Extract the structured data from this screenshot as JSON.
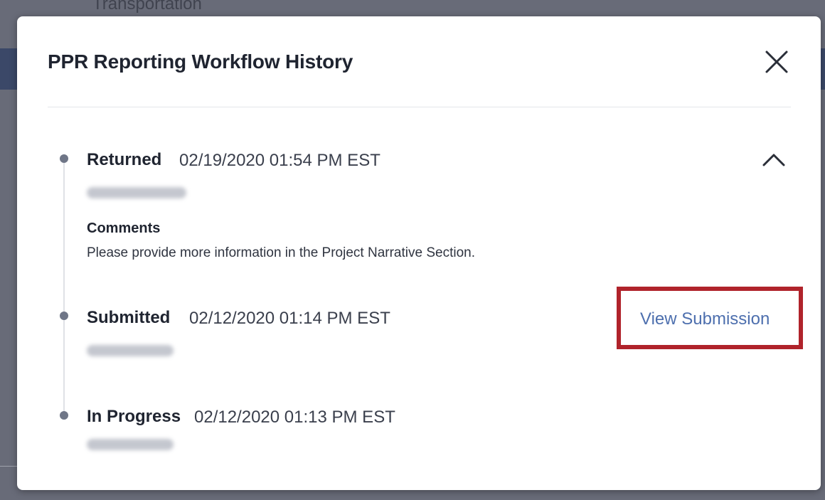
{
  "background": {
    "partial_text": "Transportation"
  },
  "modal": {
    "title": "PPR Reporting Workflow History",
    "close_icon": "close-icon",
    "collapse_icon": "chevron-up-icon"
  },
  "history": [
    {
      "status": "Returned",
      "timestamp": "02/19/2020 01:54 PM EST",
      "user": "",
      "comments_heading": "Comments",
      "comments_text": "Please provide more information in the Project Narrative Section."
    },
    {
      "status": "Submitted",
      "timestamp": "02/12/2020 01:14 PM EST",
      "user": "",
      "link_label": "View Submission"
    },
    {
      "status": "In Progress",
      "timestamp": "02/12/2020 01:13 PM EST",
      "user": ""
    }
  ],
  "colors": {
    "link": "#4d6fae",
    "highlight": "#b0232b",
    "timeline_dot": "#6f7687"
  }
}
